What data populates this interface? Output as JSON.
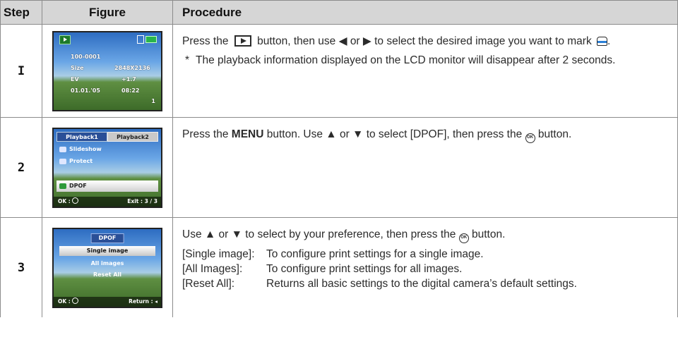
{
  "headers": {
    "step": "Step",
    "figure": "Figure",
    "procedure": "Procedure"
  },
  "steps": [
    {
      "num": "I",
      "screen": {
        "file_no": "100-0001",
        "size_label": "Size",
        "size_value": "2848X2136",
        "ev_label": "EV",
        "ev_value": "+1.7",
        "date": "01.01.'05",
        "time": "08:22",
        "frame": "1"
      },
      "text_before_play": "Press the",
      "text_after_play": "button, then use ◀ or ▶ to select the desired image you want to mark",
      "text_end": ".",
      "note_star": "*",
      "note": "The playback information displayed on the LCD monitor will disappear after 2 seconds."
    },
    {
      "num": "2",
      "screen": {
        "tab1": "Playback1",
        "tab2": "Playback2",
        "items": [
          "Slideshow",
          "Protect",
          "DPOF"
        ],
        "ok_label": "OK :",
        "exit_label": "Exit :",
        "page": "3 / 3"
      },
      "text_a": "Press the ",
      "text_bold": "MENU",
      "text_b": " button. Use ▲ or ▼ to select [DPOF], then press the",
      "text_c": "button."
    },
    {
      "num": "3",
      "screen": {
        "title": "DPOF",
        "options": [
          "Single image",
          "All images",
          "Reset All"
        ],
        "ok_label": "OK :",
        "return_label": "Return :"
      },
      "text_a": "Use ▲ or ▼ to select by your preference, then press the",
      "text_b": "button.",
      "definitions": [
        {
          "key": "[Single image]:",
          "desc": "To configure print settings for a single image."
        },
        {
          "key": "[All Images]:",
          "desc": "To configure print settings for all images."
        },
        {
          "key": "[Reset All]:",
          "desc": "Returns all basic settings to the digital camera’s default settings."
        }
      ]
    }
  ]
}
